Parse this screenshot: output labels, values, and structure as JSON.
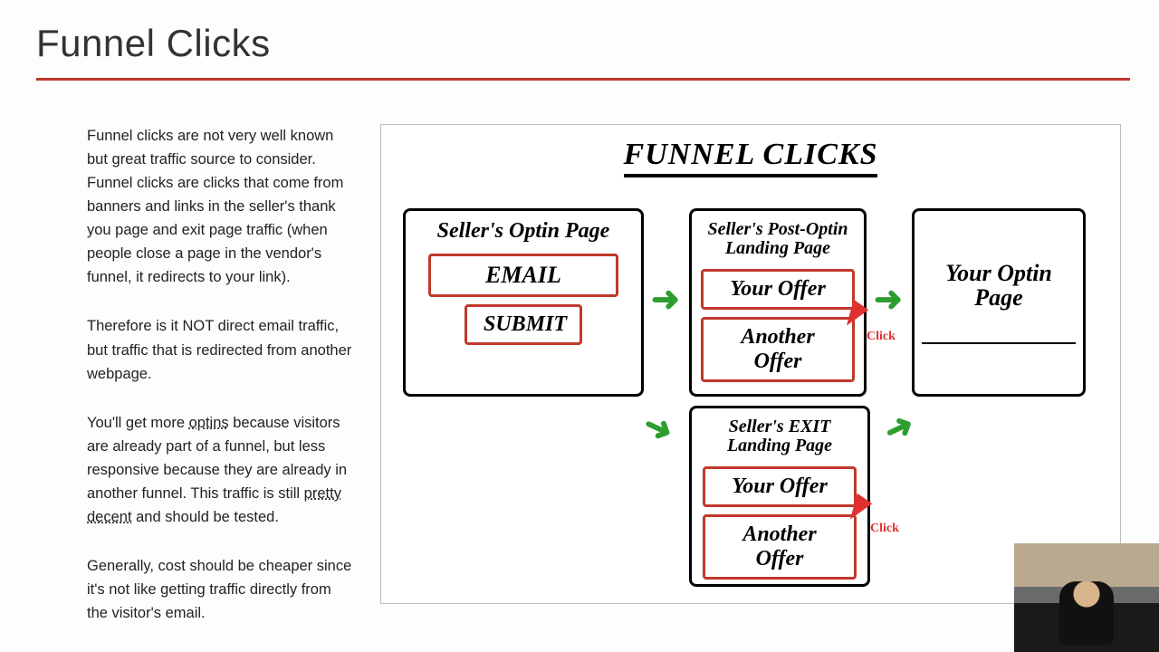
{
  "title": "Funnel Clicks",
  "paragraphs": {
    "p1": "Funnel clicks are not very well known but great traffic source to consider. Funnel clicks are clicks that come from banners and links in the seller's thank you page and exit page traffic (when people close a page in the vendor's funnel, it redirects to your link).",
    "p2": "Therefore is it NOT direct email traffic, but traffic that is redirected from another webpage.",
    "p3_a": "You'll get more ",
    "p3_u1": "optins",
    "p3_b": " because visitors are already part of a funnel, but less responsive because they are already in another funnel.  This traffic is still ",
    "p3_u2": "pretty decent",
    "p3_c": " and should be tested.",
    "p4": "Generally, cost should be cheaper since it's not like getting traffic directly from the visitor's email."
  },
  "diagram": {
    "title": "FUNNEL CLICKS",
    "optin": {
      "heading": "Seller's Optin Page",
      "email": "EMAIL",
      "submit": "SUBMIT"
    },
    "post": {
      "heading": "Seller's Post-Optin Landing Page",
      "offer1": "Your Offer",
      "offer2": "Another Offer"
    },
    "your": {
      "heading": "Your Optin Page"
    },
    "exit": {
      "heading": "Seller's EXIT Landing Page",
      "offer1": "Your Offer",
      "offer2": "Another Offer"
    },
    "click_label": "Click"
  }
}
